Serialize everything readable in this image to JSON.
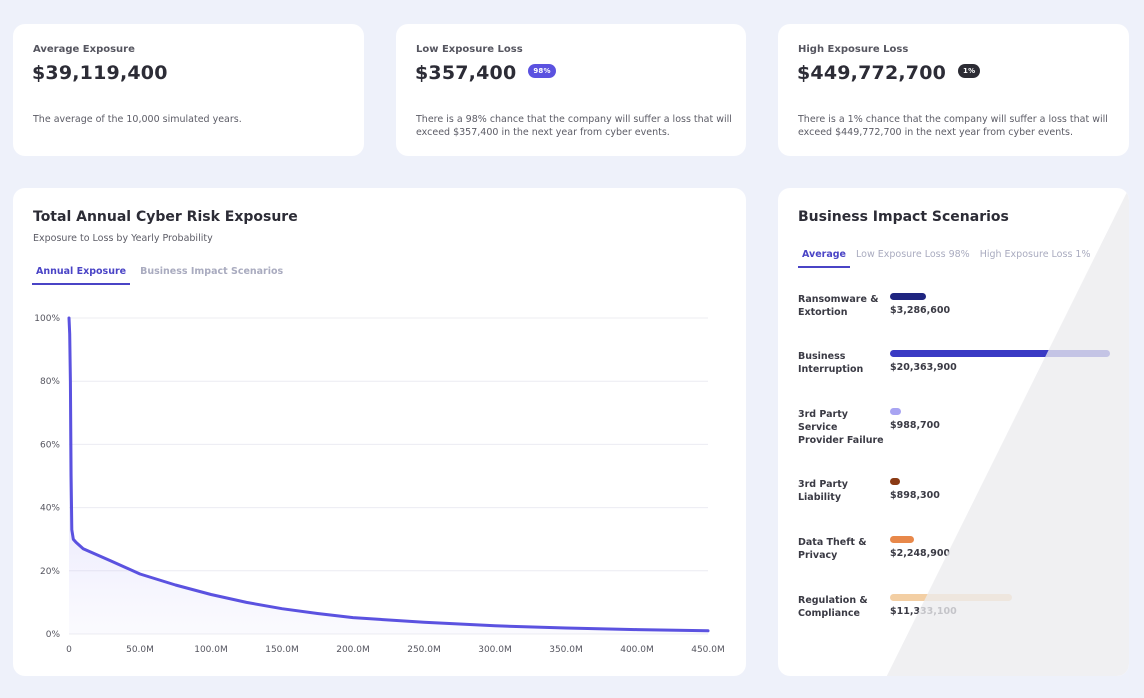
{
  "kpis": [
    {
      "label": "Average Exposure",
      "value": "$39,119,400",
      "badge": "",
      "badge_color": "",
      "desc": "The average of the 10,000 simulated years."
    },
    {
      "label": "Low Exposure Loss",
      "value": "$357,400",
      "badge": "98%",
      "badge_color": "#5b52e0",
      "desc": "There is a 98% chance that the company will suffer a loss that will exceed $357,400 in the next year from cyber events."
    },
    {
      "label": "High Exposure Loss",
      "value": "$449,772,700",
      "badge": "1%",
      "badge_color": "#2c2c34",
      "desc": "There is a 1% chance that the company will suffer a loss that will exceed $449,772,700 in the next year from cyber events."
    }
  ],
  "exposure_panel": {
    "title": "Total Annual Cyber Risk Exposure",
    "subtitle": "Exposure to Loss by Yearly Probability",
    "tabs": [
      "Annual Exposure",
      "Business Impact Scenarios"
    ],
    "active_tab": 0
  },
  "chart_data": {
    "type": "area",
    "title": "Total Annual Cyber Risk Exposure",
    "subtitle": "Exposure to Loss by Yearly Probability",
    "xlabel": "",
    "ylabel": "",
    "x_ticks": [
      "0",
      "50.0M",
      "100.0M",
      "150.0M",
      "200.0M",
      "250.0M",
      "300.0M",
      "350.0M",
      "400.0M",
      "450.0M"
    ],
    "y_ticks": [
      "0%",
      "20%",
      "40%",
      "60%",
      "80%",
      "100%"
    ],
    "xlim": [
      0,
      450
    ],
    "ylim": [
      0,
      100
    ],
    "x_unit": "M",
    "grid": true,
    "line_color": "#5b52e0",
    "series": [
      {
        "x": [
          0,
          0.5,
          1,
          1.5,
          2,
          3,
          5,
          10,
          20,
          30,
          40,
          50,
          75,
          100,
          125,
          150,
          175,
          200,
          250,
          300,
          350,
          400,
          450
        ],
        "y": [
          100,
          95,
          80,
          50,
          33,
          30,
          29,
          27,
          25,
          23,
          21,
          19,
          15.5,
          12.5,
          10,
          8,
          6.5,
          5.2,
          3.7,
          2.6,
          1.9,
          1.4,
          1
        ]
      }
    ]
  },
  "bis_panel": {
    "title": "Business Impact Scenarios",
    "tabs": [
      "Average",
      "Low Exposure Loss 98%",
      "High Exposure Loss 1%"
    ],
    "active_tab": 0,
    "scale_max": 20363900,
    "items": [
      {
        "label": "Ransomware & Extortion",
        "value": "$3,286,600",
        "amount": 3286600,
        "color": "#1f2580"
      },
      {
        "label": "Business Interruption",
        "value": "$20,363,900",
        "amount": 20363900,
        "color": "#3a3ac4"
      },
      {
        "label": "3rd Party Service Provider Failure",
        "value": "$988,700",
        "amount": 988700,
        "color": "#a8a4f2"
      },
      {
        "label": "3rd Party Liability",
        "value": "$898,300",
        "amount": 898300,
        "color": "#8a3a14"
      },
      {
        "label": "Data Theft & Privacy",
        "value": "$2,248,900",
        "amount": 2248900,
        "color": "#e8884a"
      },
      {
        "label": "Regulation & Compliance",
        "value": "$11,333,100",
        "amount": 11333100,
        "color": "#f3cfa4"
      }
    ]
  }
}
